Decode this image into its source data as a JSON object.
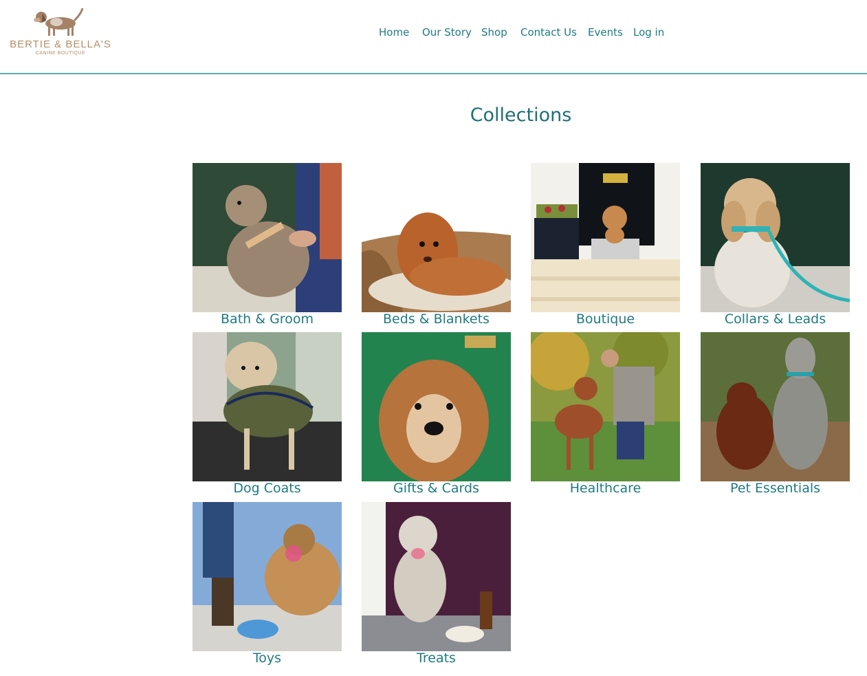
{
  "brand": {
    "name": "BERTIE & BELLA'S",
    "tagline": "CANINE BOUTIQUE",
    "logo_icon": "beagle-dog-icon",
    "color": "#b58f68"
  },
  "nav": {
    "items": [
      {
        "label": "Home"
      },
      {
        "label": "Our Story"
      },
      {
        "label": "Shop"
      },
      {
        "label": "Contact Us"
      },
      {
        "label": "Events"
      },
      {
        "label": "Log in"
      }
    ]
  },
  "page": {
    "title": "Collections"
  },
  "collections": [
    {
      "label": "Bath & Groom"
    },
    {
      "label": "Beds & Blankets"
    },
    {
      "label": "Boutique"
    },
    {
      "label": "Collars & Leads"
    },
    {
      "label": "Dog Coats"
    },
    {
      "label": "Gifts & Cards"
    },
    {
      "label": "Healthcare"
    },
    {
      "label": "Pet Essentials"
    },
    {
      "label": "Toys"
    },
    {
      "label": "Treats"
    }
  ],
  "colors": {
    "accent": "#1f7a80",
    "divider": "#5fa8ab"
  }
}
